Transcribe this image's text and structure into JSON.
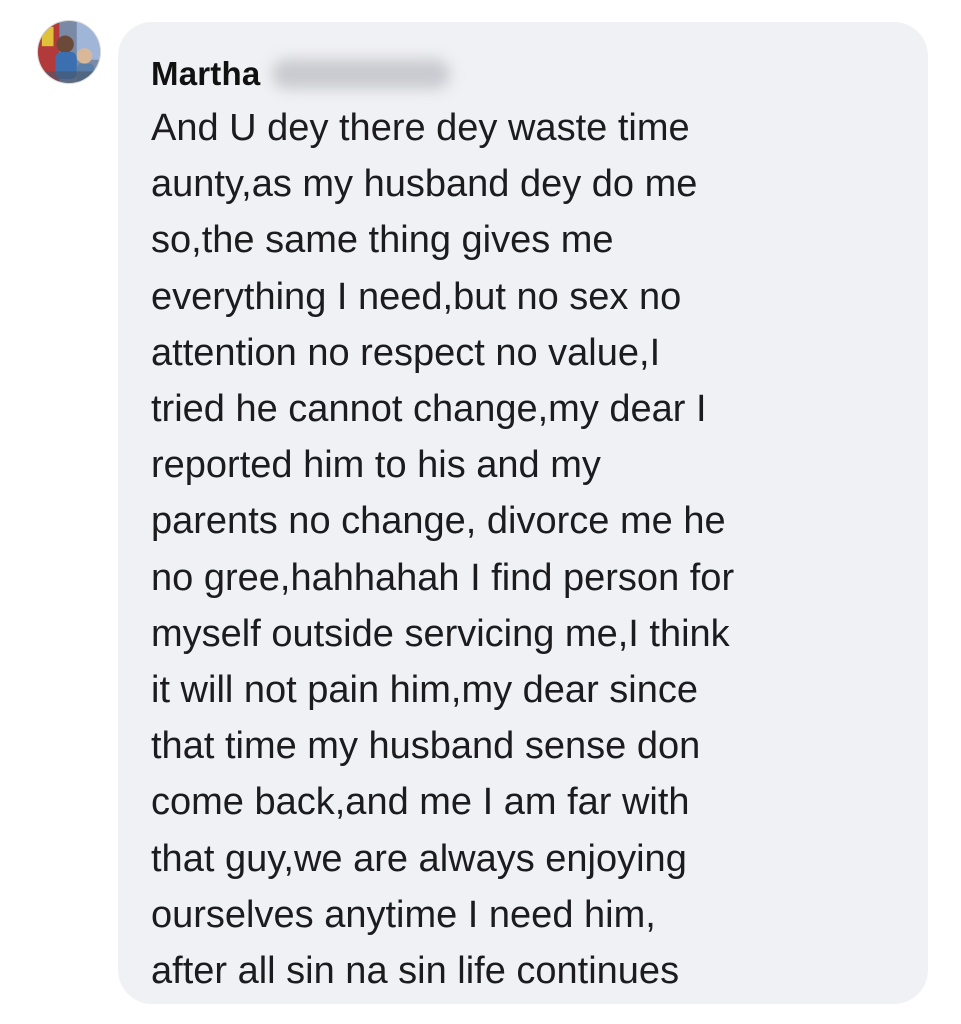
{
  "comment": {
    "author_name": "Martha",
    "avatar_icon": "profile-photo",
    "author_surname_obscured": true,
    "lines": [
      "And U dey there dey waste time",
      "aunty,as my husband dey do me",
      "so,the same thing gives me",
      "everything I need,but no sex no",
      "attention no respect no value,I",
      "tried he cannot change,my dear I",
      "reported him to his and my",
      "parents no change, divorce me he",
      "no gree,hahhahah I find person for",
      "myself outside servicing me,I think",
      "it will not pain him,my dear since",
      "that time my husband sense don",
      "come back,and me I am far with",
      "that guy,we are always enjoying",
      "ourselves anytime I need him,",
      "after all sin na sin life continues"
    ]
  },
  "colors": {
    "bubble_background": "#f0f1f5",
    "text": "#1c1c1e",
    "page_background": "#ffffff"
  }
}
